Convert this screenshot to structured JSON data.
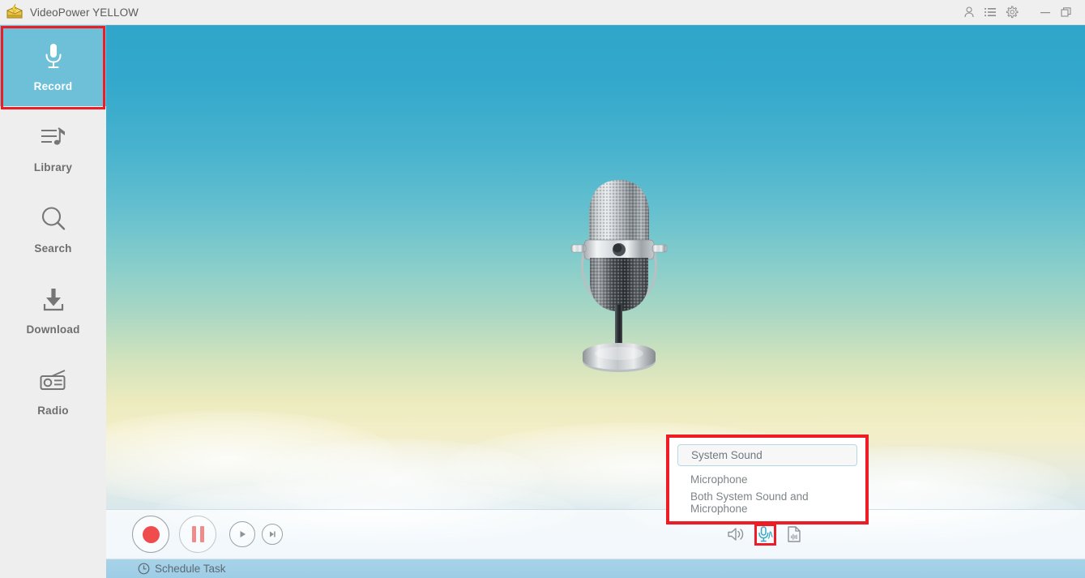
{
  "titlebar": {
    "app_title": "VideoPower YELLOW",
    "app_icon": "videopower-logo-icon",
    "buttons": [
      {
        "name": "account-icon",
        "label": "Account"
      },
      {
        "name": "list-icon",
        "label": "Task List"
      },
      {
        "name": "gear-icon",
        "label": "Settings"
      },
      {
        "name": "minimize-icon",
        "label": "Minimize"
      },
      {
        "name": "restore-icon",
        "label": "Restore"
      }
    ]
  },
  "sidebar": {
    "items": [
      {
        "label": "Record",
        "icon": "microphone-icon",
        "active": true
      },
      {
        "label": "Library",
        "icon": "music-list-icon",
        "active": false
      },
      {
        "label": "Search",
        "icon": "magnifier-icon",
        "active": false
      },
      {
        "label": "Download",
        "icon": "download-arrow-icon",
        "active": false
      },
      {
        "label": "Radio",
        "icon": "radio-icon",
        "active": false
      }
    ]
  },
  "stage": {
    "artwork": "vintage-microphone-illustration"
  },
  "controls": {
    "record": "Record",
    "pause": "Pause",
    "play": "Play",
    "next": "Next",
    "source_icons": [
      {
        "name": "speaker-icon",
        "label": "System Sound",
        "active": false
      },
      {
        "name": "microphone-icon",
        "label": "Microphone",
        "active": true
      },
      {
        "name": "audio-file-icon",
        "label": "Audio File",
        "active": false
      }
    ]
  },
  "statusbar": {
    "schedule_task": "Schedule Task",
    "clock_icon": "clock-icon"
  },
  "dropdown": {
    "items": [
      {
        "label": "System Sound",
        "selected": true
      },
      {
        "label": "Microphone",
        "selected": false
      },
      {
        "label": "Both System Sound and Microphone",
        "selected": false
      }
    ]
  },
  "colors": {
    "accent": "#6ec0d8",
    "highlight": "#ee1c25",
    "sidebar_bg": "#eeeeee",
    "titlebar_bg": "#efefef",
    "record_dot": "#ef4d4d",
    "pause_bar": "#f08b8b",
    "statusbar_bg": "#a8d3e8"
  }
}
